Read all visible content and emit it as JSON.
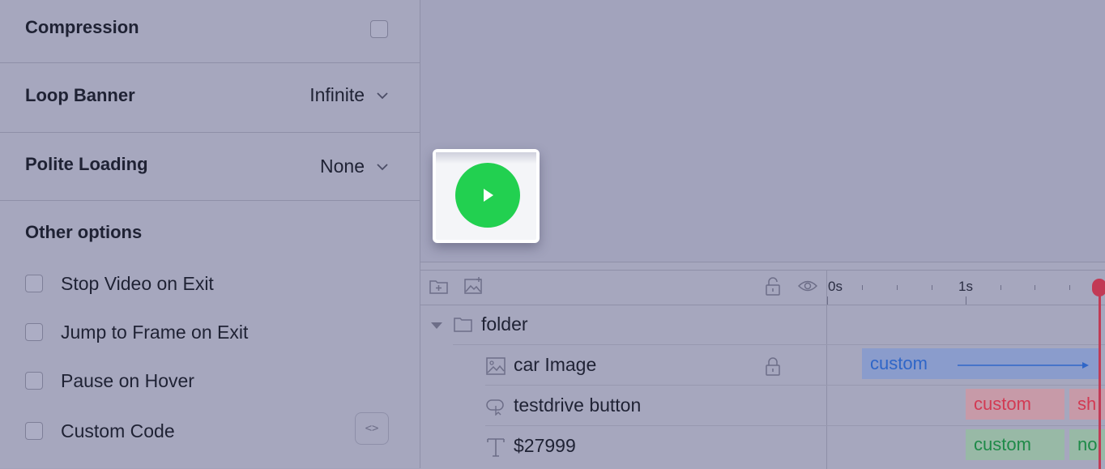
{
  "settings": {
    "compression_label": "Compression",
    "loop_banner_label": "Loop Banner",
    "loop_banner_value": "Infinite",
    "polite_loading_label": "Polite Loading",
    "polite_loading_value": "None",
    "other_options_label": "Other options",
    "options": [
      {
        "label": "Stop Video on Exit",
        "checked": false
      },
      {
        "label": "Jump to Frame on Exit",
        "checked": false
      },
      {
        "label": "Pause on Hover",
        "checked": false
      },
      {
        "label": "Custom Code",
        "checked": false
      }
    ],
    "custom_code_glyph": "<>"
  },
  "timeline": {
    "ruler": {
      "start": "0s",
      "mark": "1s"
    },
    "layers": [
      {
        "name": "folder",
        "type": "folder"
      },
      {
        "name": "car Image",
        "type": "image",
        "locked": true
      },
      {
        "name": "testdrive button",
        "type": "button"
      },
      {
        "name": "$27999",
        "type": "text"
      }
    ],
    "bars": {
      "car_image": "custom",
      "button_1": "custom",
      "button_2": "sh",
      "price_1": "custom",
      "price_2": "no"
    }
  },
  "colors": {
    "play_button": "#22d050",
    "playhead": "#c23a55",
    "bar_blue_text": "#2f66c8",
    "bar_red_text": "#d23a53",
    "bar_green_text": "#1e8a48"
  },
  "icons": {
    "add_folder": "folder-plus-icon",
    "add_image": "image-plus-icon",
    "lock": "lock-icon",
    "visibility": "eye-icon",
    "play": "play-icon"
  }
}
